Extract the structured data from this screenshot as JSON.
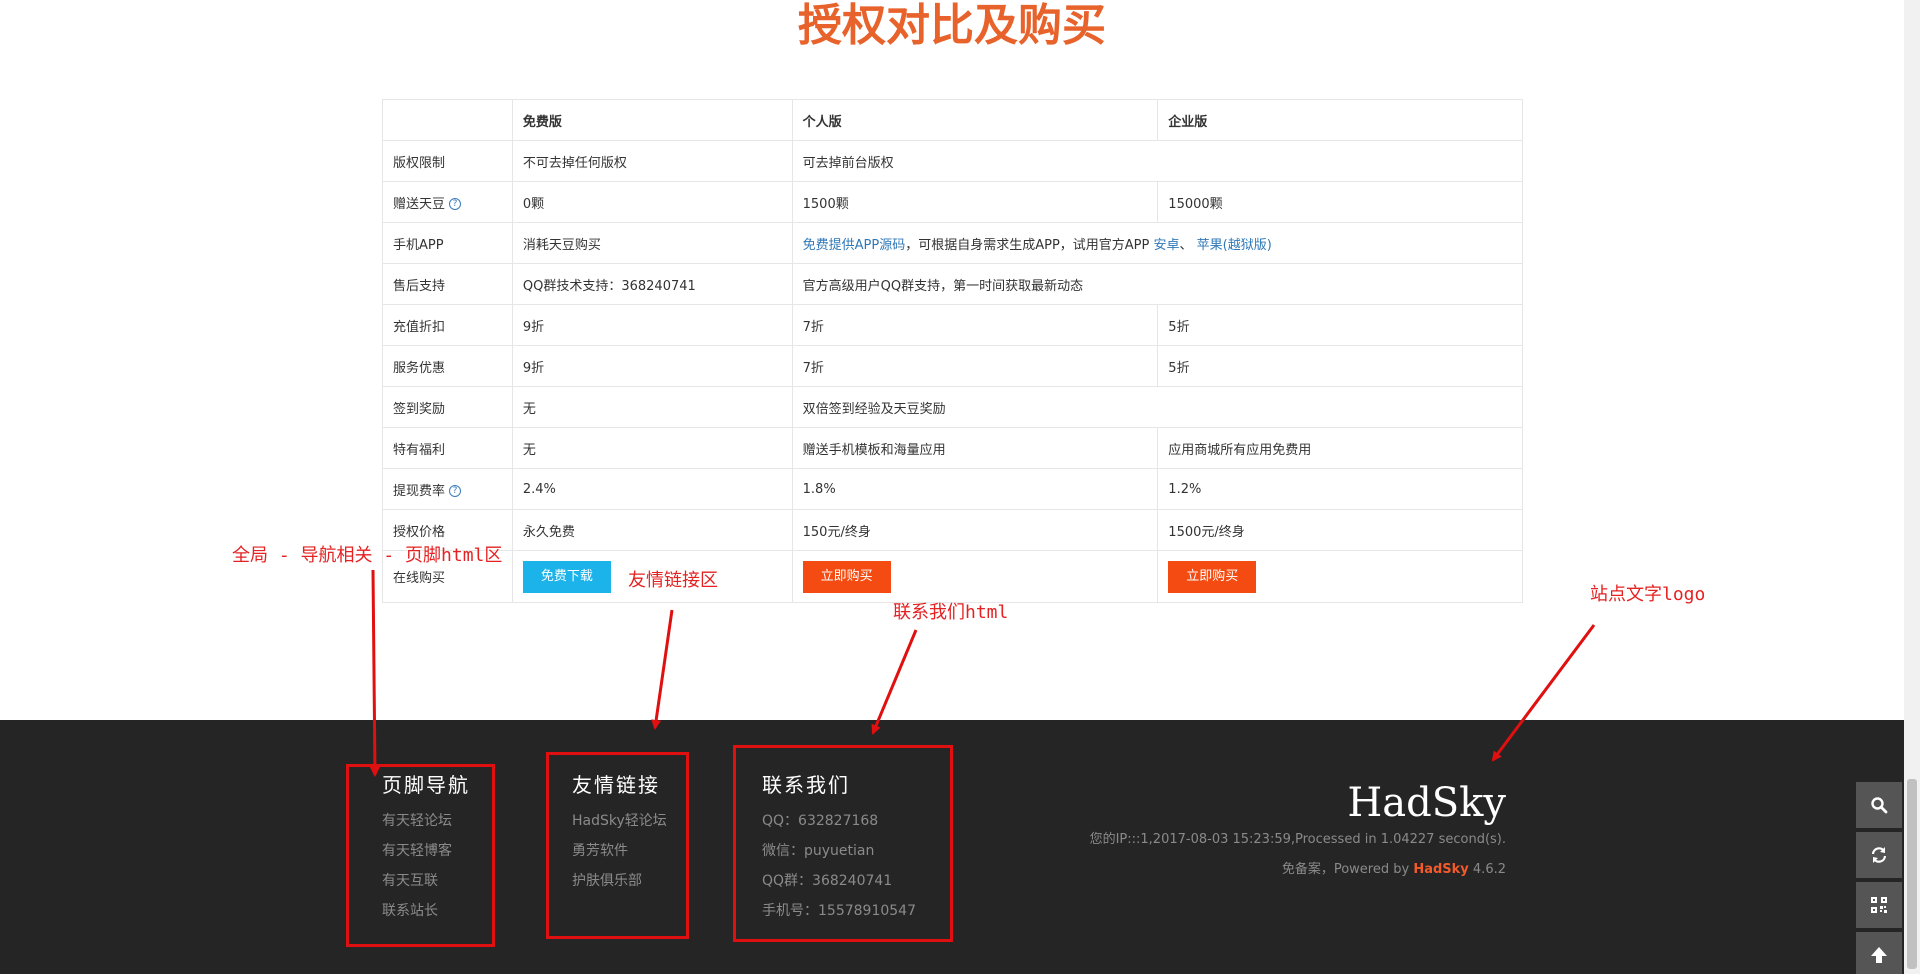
{
  "title": "授权对比及购买",
  "table": {
    "headers": [
      "",
      "免费版",
      "个人版",
      "企业版"
    ],
    "rows": {
      "copyright": {
        "label": "版权限制",
        "free": "不可去掉任何版权",
        "personal": "可去掉前台版权"
      },
      "beans": {
        "label": "赠送天豆",
        "free": "0颗",
        "personal": "1500颗",
        "enterprise": "15000颗"
      },
      "app": {
        "label": "手机APP",
        "free": "消耗天豆购买",
        "link1": "免费提供APP源码",
        "mid": "，可根据自身需求生成APP，试用官方APP ",
        "android": "安卓",
        "sep": "、 ",
        "apple": "苹果(越狱版)"
      },
      "support": {
        "label": "售后支持",
        "free": "QQ群技术支持：368240741",
        "personal": "官方高级用户QQ群支持，第一时间获取最新动态"
      },
      "recharge": {
        "label": "充值折扣",
        "free": "9折",
        "personal": "7折",
        "enterprise": "5折"
      },
      "service": {
        "label": "服务优惠",
        "free": "9折",
        "personal": "7折",
        "enterprise": "5折"
      },
      "signin": {
        "label": "签到奖励",
        "free": "无",
        "personal": "双倍签到经验及天豆奖励"
      },
      "welfare": {
        "label": "特有福利",
        "free": "无",
        "personal": "赠送手机模板和海量应用",
        "enterprise": "应用商城所有应用免费用"
      },
      "fee": {
        "label": "提现费率",
        "free": "2.4%",
        "personal": "1.8%",
        "enterprise": "1.2%"
      },
      "price": {
        "label": "授权价格",
        "free": "永久免费",
        "personal": "150元/终身",
        "enterprise": "1500元/终身"
      },
      "buy": {
        "label": "在线购买",
        "free_btn": "免费下载",
        "personal_btn": "立即购买",
        "enterprise_btn": "立即购买"
      }
    },
    "help_glyph": "?"
  },
  "footer": {
    "nav": {
      "title": "页脚导航",
      "links": [
        "有天轻论坛",
        "有天轻博客",
        "有天互联",
        "联系站长"
      ]
    },
    "friends": {
      "title": "友情链接",
      "links": [
        "HadSky轻论坛",
        "勇芳软件",
        "护肤俱乐部"
      ]
    },
    "contact": {
      "title": "联系我们",
      "items": [
        "QQ：632827168",
        "微信：puyuetian",
        "QQ群：368240741",
        "手机号：15578910547"
      ]
    },
    "brand": "HadSky",
    "info_line": "您的IP:::1,2017-08-03 15:23:59,Processed in 1.04227 second(s).",
    "powered_prefix": "免备案，Powered by ",
    "powered_name": "HadSky",
    "powered_version": " 4.6.2"
  },
  "tools": [
    "search-icon",
    "refresh-icon",
    "qrcode-icon",
    "arrow-up-icon"
  ],
  "annotations": {
    "global_footer": "全局 - 导航相关 - 页脚html区",
    "friend_links": "友情链接区",
    "contact_html": "联系我们html",
    "site_logo": "站点文字logo"
  },
  "colors": {
    "title": "#e8622b",
    "link": "#2f78b8",
    "free_button": "#1bb3ea",
    "buy_button": "#f34b12",
    "footer_bg": "#252525",
    "annotation": "#e52222"
  }
}
